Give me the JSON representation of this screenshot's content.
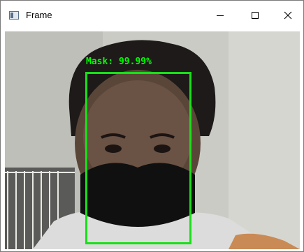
{
  "window": {
    "title": "Frame",
    "controls": {
      "minimize": "minimize",
      "maximize": "maximize",
      "close": "close"
    }
  },
  "detection": {
    "label": "Mask: 99.99%",
    "color": "#00ff00"
  },
  "icons": [
    "app-window-icon",
    "minimize-icon",
    "maximize-icon",
    "close-icon"
  ]
}
